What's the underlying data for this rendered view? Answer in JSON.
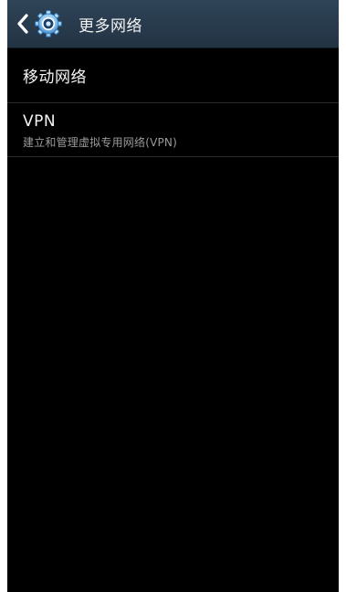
{
  "action_bar": {
    "title": "更多网络",
    "back_icon": "chevron-left-icon",
    "app_icon": "settings-gear-icon",
    "accent_color": "#2a3b4c"
  },
  "menu": {
    "items": [
      {
        "title": "移动网络"
      },
      {
        "title": "VPN",
        "subtitle": "建立和管理虚拟专用网络(VPN)"
      }
    ]
  }
}
